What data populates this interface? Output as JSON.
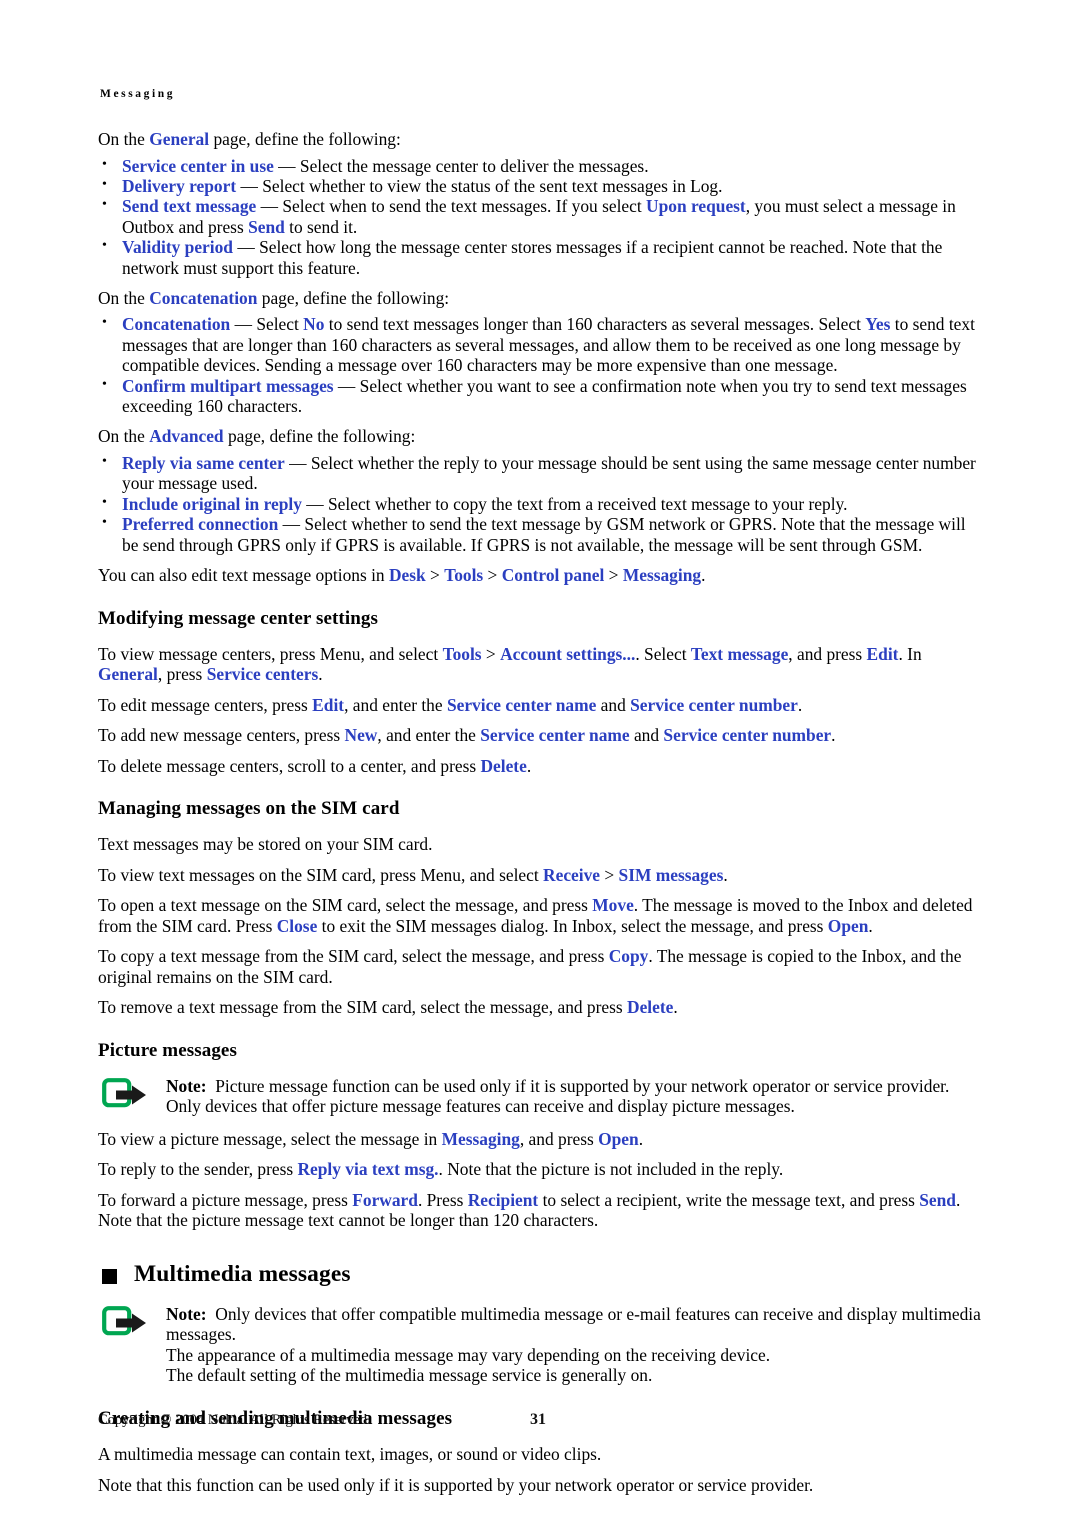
{
  "running_header": "Messaging",
  "colors": {
    "link_blue": "#2b3fc0",
    "note_icon_green": "#00a651",
    "note_icon_arrow": "#1a1a1a",
    "text_black": "#000000",
    "page_background": "#ffffff"
  },
  "general_section": {
    "intro_pre": "On the ",
    "intro_term": "General",
    "intro_post": " page, define the following:",
    "bullets": [
      {
        "term": "Service center in use",
        "dash": " — ",
        "text": "Select the message center to deliver the messages."
      },
      {
        "term": "Delivery report",
        "dash": " — ",
        "text": "Select whether to view the status of the sent text messages in Log."
      },
      {
        "term": "Send text message",
        "dash": " — ",
        "text_a": "Select when to send the text messages. If you select ",
        "inline_term": "Upon request",
        "text_b": ", you must select a message in Outbox and press ",
        "inline_term_2": "Send",
        "text_c": " to send it."
      },
      {
        "term": "Validity period",
        "dash": " — ",
        "text": "Select how long the message center stores messages if a recipient cannot be reached. Note that the network must support this feature."
      }
    ]
  },
  "concatenation_section": {
    "intro_pre": "On the ",
    "intro_term": "Concatenation",
    "intro_post": " page, define the following:",
    "bullets": [
      {
        "term": "Concatenation",
        "dash": " — ",
        "text_a": "Select ",
        "inline_term": "No",
        "text_b": " to send text messages longer than 160 characters as several messages. Select ",
        "inline_term_2": "Yes",
        "text_c": " to send text messages that are longer than 160 characters as several messages, and allow them to be received as one long message by compatible devices. Sending a message over 160 characters may be more expensive than one message."
      },
      {
        "term": "Confirm multipart messages",
        "dash": " — ",
        "text": "Select whether you want to see a confirmation note when you try to send text messages exceeding 160 characters."
      }
    ]
  },
  "advanced_section": {
    "intro_pre": "On the ",
    "intro_term": "Advanced",
    "intro_post": " page, define the following:",
    "bullets": [
      {
        "term": "Reply via same center",
        "dash": "  — ",
        "text": "Select whether the reply to your message should be sent using the same message center number your message used."
      },
      {
        "term": "Include original in reply",
        "dash": "  — ",
        "text": "Select whether to copy the text from a received text message to your reply."
      },
      {
        "term": "Preferred connection",
        "dash": " — ",
        "text": "Select whether to send the text message by GSM network or GPRS. Note that the message will be send through GPRS only if GPRS is available. If GPRS is not available, the message will be sent through GSM."
      }
    ],
    "path_sentence": {
      "pre": "You can also edit text message options in ",
      "steps": [
        "Desk",
        "Tools",
        "Control panel",
        "Messaging"
      ],
      "separator": " > ",
      "post": "."
    }
  },
  "modifying_section": {
    "heading": "Modifying message center settings",
    "paragraphs": [
      {
        "id": "view-centers",
        "parts": [
          {
            "t": "To view message centers, press Menu, and select ",
            "k": "plain"
          },
          {
            "t": "Tools",
            "k": "term"
          },
          {
            "t": " > ",
            "k": "plain"
          },
          {
            "t": "Account settings...",
            "k": "term"
          },
          {
            "t": ". Select ",
            "k": "plain"
          },
          {
            "t": "Text message",
            "k": "term"
          },
          {
            "t": ", and press ",
            "k": "plain"
          },
          {
            "t": "Edit",
            "k": "term"
          },
          {
            "t": ". In ",
            "k": "plain"
          },
          {
            "t": "General",
            "k": "term"
          },
          {
            "t": ", press ",
            "k": "plain"
          },
          {
            "t": "Service centers",
            "k": "term"
          },
          {
            "t": ".",
            "k": "plain"
          }
        ]
      },
      {
        "id": "edit-centers",
        "parts": [
          {
            "t": "To edit message centers, press ",
            "k": "plain"
          },
          {
            "t": "Edit",
            "k": "term"
          },
          {
            "t": ", and enter the ",
            "k": "plain"
          },
          {
            "t": "Service center name",
            "k": "term"
          },
          {
            "t": " and ",
            "k": "plain"
          },
          {
            "t": "Service center number",
            "k": "term"
          },
          {
            "t": ".",
            "k": "plain"
          }
        ]
      },
      {
        "id": "add-centers",
        "parts": [
          {
            "t": "To add new message centers, press ",
            "k": "plain"
          },
          {
            "t": "New",
            "k": "term"
          },
          {
            "t": ", and enter the ",
            "k": "plain"
          },
          {
            "t": "Service center name",
            "k": "term"
          },
          {
            "t": " and ",
            "k": "plain"
          },
          {
            "t": "Service center number",
            "k": "term"
          },
          {
            "t": ".",
            "k": "plain"
          }
        ]
      },
      {
        "id": "delete-centers",
        "parts": [
          {
            "t": "To delete message centers, scroll to a center, and press ",
            "k": "plain"
          },
          {
            "t": "Delete",
            "k": "term"
          },
          {
            "t": ".",
            "k": "plain"
          }
        ]
      }
    ]
  },
  "sim_section": {
    "heading": "Managing messages on the SIM card",
    "paragraphs": [
      {
        "id": "sim-stored",
        "parts": [
          {
            "t": "Text messages may be stored on your SIM card.",
            "k": "plain"
          }
        ]
      },
      {
        "id": "sim-view",
        "parts": [
          {
            "t": "To view text messages on the SIM card, press Menu, and select ",
            "k": "plain"
          },
          {
            "t": "Receive",
            "k": "term"
          },
          {
            "t": " > ",
            "k": "plain"
          },
          {
            "t": "SIM messages",
            "k": "term"
          },
          {
            "t": ".",
            "k": "plain"
          }
        ]
      },
      {
        "id": "sim-open",
        "parts": [
          {
            "t": "To open a text message on the SIM card, select the message, and press ",
            "k": "plain"
          },
          {
            "t": "Move",
            "k": "term"
          },
          {
            "t": ". The message is moved to the Inbox and deleted from the SIM card. Press ",
            "k": "plain"
          },
          {
            "t": "Close",
            "k": "term"
          },
          {
            "t": " to exit the SIM messages dialog. In Inbox, select the message, and press ",
            "k": "plain"
          },
          {
            "t": "Open",
            "k": "term"
          },
          {
            "t": ".",
            "k": "plain"
          }
        ]
      },
      {
        "id": "sim-copy",
        "parts": [
          {
            "t": "To copy a text message from the SIM card, select the message, and press ",
            "k": "plain"
          },
          {
            "t": "Copy",
            "k": "term"
          },
          {
            "t": ". The message is copied to the Inbox, and the original remains on the SIM card.",
            "k": "plain"
          }
        ]
      },
      {
        "id": "sim-remove",
        "parts": [
          {
            "t": "To remove a text message from the SIM card, select the message, and press ",
            "k": "plain"
          },
          {
            "t": "Delete",
            "k": "term"
          },
          {
            "t": ".",
            "k": "plain"
          }
        ]
      }
    ]
  },
  "picture_section": {
    "heading": "Picture messages",
    "note": {
      "label": "Note:",
      "icon": "note-arrow-icon",
      "text": "Picture message function can be used only if it is supported by your network operator or service provider. Only devices that offer picture message features can receive and display picture messages."
    },
    "paragraphs": [
      {
        "id": "pic-view",
        "parts": [
          {
            "t": "To view a picture message, select the message in ",
            "k": "plain"
          },
          {
            "t": "Messaging",
            "k": "term"
          },
          {
            "t": ", and press ",
            "k": "plain"
          },
          {
            "t": "Open",
            "k": "term"
          },
          {
            "t": ".",
            "k": "plain"
          }
        ]
      },
      {
        "id": "pic-reply",
        "parts": [
          {
            "t": "To reply to the sender, press ",
            "k": "plain"
          },
          {
            "t": "Reply via text msg.",
            "k": "term"
          },
          {
            "t": ". Note that the picture is not included in the reply.",
            "k": "plain"
          }
        ]
      },
      {
        "id": "pic-forward",
        "parts": [
          {
            "t": "To forward a picture message, press ",
            "k": "plain"
          },
          {
            "t": "Forward",
            "k": "term"
          },
          {
            "t": ". Press ",
            "k": "plain"
          },
          {
            "t": "Recipient",
            "k": "term"
          },
          {
            "t": " to select a recipient, write the message text, and press ",
            "k": "plain"
          },
          {
            "t": "Send",
            "k": "term"
          },
          {
            "t": ". Note that the picture message text cannot be longer than 120 characters.",
            "k": "plain"
          }
        ]
      }
    ]
  },
  "multimedia_section": {
    "heading": "Multimedia messages",
    "bullet_glyph": "square-bullet",
    "note": {
      "label": "Note:",
      "icon": "note-arrow-icon",
      "lines": [
        "Only devices that offer compatible multimedia message or e-mail features can receive and display multimedia messages.",
        "The appearance of a multimedia message may vary depending on the receiving device.",
        "The default setting of the multimedia message service is generally on."
      ]
    },
    "subheading": "Creating and sending multimedia messages",
    "paragraphs": [
      {
        "id": "mms-contains",
        "parts": [
          {
            "t": "A multimedia message can contain text, images, or sound or video clips.",
            "k": "plain"
          }
        ]
      },
      {
        "id": "mms-support",
        "parts": [
          {
            "t": "Note that this function can be used only if it is supported by your network operator or service provider.",
            "k": "plain"
          }
        ]
      }
    ]
  },
  "footer": {
    "copyright": "Copyright © 2004 Nokia. All Rights Reserved.",
    "page_number": "31"
  }
}
